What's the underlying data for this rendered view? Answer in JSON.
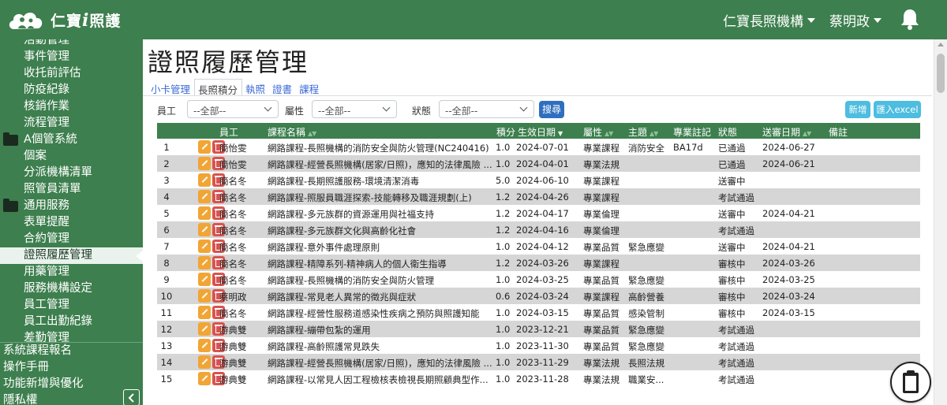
{
  "header": {
    "logo_text": "仁寶",
    "logo_i": "i",
    "logo_text2": "照護",
    "org_name": "仁寶長照機構",
    "user_name": "蔡明政",
    "icons": [
      "cloud-logo-icon",
      "bell-icon",
      "caret-down-icon"
    ]
  },
  "sidebar": {
    "items_upper": [
      {
        "label": "活動管理",
        "type": "item"
      },
      {
        "label": "事件管理",
        "type": "item"
      },
      {
        "label": "收托前評估",
        "type": "item"
      },
      {
        "label": "防疫紀錄",
        "type": "item"
      },
      {
        "label": "核銷作業",
        "type": "item"
      },
      {
        "label": "流程管理",
        "type": "item"
      },
      {
        "label": "A個管系統",
        "type": "group"
      },
      {
        "label": "個案",
        "type": "item"
      },
      {
        "label": "分派機構清單",
        "type": "item"
      },
      {
        "label": "照管員清單",
        "type": "item"
      },
      {
        "label": "通用服務",
        "type": "group"
      },
      {
        "label": "表單提醒",
        "type": "item"
      },
      {
        "label": "合約管理",
        "type": "item"
      },
      {
        "label": "證照履歷管理",
        "type": "item",
        "active": true
      },
      {
        "label": "用藥管理",
        "type": "item"
      },
      {
        "label": "服務機構設定",
        "type": "item"
      },
      {
        "label": "員工管理",
        "type": "item"
      },
      {
        "label": "員工出勤紀錄",
        "type": "item"
      },
      {
        "label": "差勤管理",
        "type": "item"
      }
    ],
    "items_lower": [
      {
        "label": "系統課程報名"
      },
      {
        "label": "操作手冊"
      },
      {
        "label": "功能新增與優化"
      },
      {
        "label": "隱私權"
      }
    ]
  },
  "page": {
    "title": "證照履歷管理",
    "tabs": [
      {
        "label": "小卡管理",
        "active": false
      },
      {
        "label": "長照積分",
        "active": true
      },
      {
        "label": "執照",
        "active": false
      },
      {
        "label": "證書",
        "active": false
      },
      {
        "label": "課程",
        "active": false
      }
    ],
    "filters": {
      "employee_label": "員工",
      "employee_value": "--全部--",
      "attribute_label": "屬性",
      "attribute_value": "--全部--",
      "status_label": "狀態",
      "status_value": "--全部--",
      "search_button": "搜尋",
      "new_button": "新增",
      "import_button": "匯入excel"
    }
  },
  "table": {
    "headers": {
      "employee": "員工",
      "course": "課程名稱",
      "points": "積分",
      "date": "生效日期",
      "attribute": "屬性",
      "topic": "主題",
      "note_code": "專業註記",
      "status": "狀態",
      "submit_date": "送審日期",
      "remark": "備註"
    },
    "rows": [
      {
        "no": "1",
        "employee": "簡怡雯",
        "course": "網路課程-長照機構的消防安全與防火管理(NC240416)",
        "points": "1.0",
        "date": "2024-07-01",
        "attribute": "專業課程",
        "topic": "消防安全",
        "note_code": "BA17d",
        "status": "已通過",
        "submit_date": "2024-06-27"
      },
      {
        "no": "2",
        "employee": "簡怡雯",
        "course": "網路課程-經營長照機構(居家/日照)，應知的法律風險 ...",
        "points": "1.0",
        "date": "2024-04-01",
        "attribute": "專業法規",
        "topic": "",
        "note_code": "",
        "status": "已通過",
        "submit_date": "2024-06-21"
      },
      {
        "no": "3",
        "employee": "簡名冬",
        "course": "網路課程-長期照護服務-環境清潔消毒",
        "points": "5.0",
        "date": "2024-06-10",
        "attribute": "專業課程",
        "topic": "",
        "note_code": "",
        "status": "送審中",
        "submit_date": ""
      },
      {
        "no": "4",
        "employee": "簡名冬",
        "course": "網路課程-照服員職涯探索-技能轉移及職涯規劃(上)",
        "points": "1.2",
        "date": "2024-04-26",
        "attribute": "專業課程",
        "topic": "",
        "note_code": "",
        "status": "考試通過",
        "submit_date": ""
      },
      {
        "no": "5",
        "employee": "簡名冬",
        "course": "網路課程-多元族群的資源運用與社福支持",
        "points": "1.2",
        "date": "2024-04-17",
        "attribute": "專業倫理",
        "topic": "",
        "note_code": "",
        "status": "送審中",
        "submit_date": "2024-04-21"
      },
      {
        "no": "6",
        "employee": "簡名冬",
        "course": "網路課程-多元族群文化與高齡化社會",
        "points": "1.2",
        "date": "2024-04-16",
        "attribute": "專業倫理",
        "topic": "",
        "note_code": "",
        "status": "考試通過",
        "submit_date": ""
      },
      {
        "no": "7",
        "employee": "簡名冬",
        "course": "網路課程-意外事件處理原則",
        "points": "1.0",
        "date": "2024-04-12",
        "attribute": "專業品質",
        "topic": "緊急應變",
        "note_code": "",
        "status": "送審中",
        "submit_date": "2024-04-21"
      },
      {
        "no": "8",
        "employee": "簡名冬",
        "course": "網路課程-精障系列-精神病人的個人衛生指導",
        "points": "1.2",
        "date": "2024-03-26",
        "attribute": "專業課程",
        "topic": "",
        "note_code": "",
        "status": "審核中",
        "submit_date": "2024-03-26"
      },
      {
        "no": "9",
        "employee": "簡名冬",
        "course": "網路課程-長照機構的消防安全與防火管理",
        "points": "1.0",
        "date": "2024-03-25",
        "attribute": "專業品質",
        "topic": "緊急應變",
        "note_code": "",
        "status": "審核中",
        "submit_date": "2024-03-25"
      },
      {
        "no": "10",
        "employee": "蔡明政",
        "course": "網路課程-常見老人異常的徵兆與症狀",
        "points": "0.6",
        "date": "2024-03-24",
        "attribute": "專業課程",
        "topic": "高齡營養",
        "note_code": "",
        "status": "審核中",
        "submit_date": "2024-03-24"
      },
      {
        "no": "11",
        "employee": "簡名冬",
        "course": "網路課程-經營性服務道感染性疾病之預防與照護知能",
        "points": "1.0",
        "date": "2024-03-15",
        "attribute": "專業品質",
        "topic": "感染管制",
        "note_code": "",
        "status": "審核中",
        "submit_date": "2024-03-15"
      },
      {
        "no": "12",
        "employee": "游典雙",
        "course": "網路課程-繃帶包紮的運用",
        "points": "1.0",
        "date": "2023-12-21",
        "attribute": "專業品質",
        "topic": "緊急應變",
        "note_code": "",
        "status": "考試通過",
        "submit_date": ""
      },
      {
        "no": "13",
        "employee": "游典雙",
        "course": "網路課程-高齡照護常見跌失",
        "points": "1.0",
        "date": "2023-11-30",
        "attribute": "專業品質",
        "topic": "緊急應變",
        "note_code": "",
        "status": "考試通過",
        "submit_date": ""
      },
      {
        "no": "14",
        "employee": "游典雙",
        "course": "網路課程-經營長照機構(居家/日照)，應知的法律風險 ...",
        "points": "1.0",
        "date": "2023-11-29",
        "attribute": "專業法規",
        "topic": "長照法規",
        "note_code": "",
        "status": "考試通過",
        "submit_date": ""
      },
      {
        "no": "15",
        "employee": "游典雙",
        "course": "網路課程-以常見人因工程檢核表檢視長期照顧典型作...",
        "points": "1.0",
        "date": "2023-11-28",
        "attribute": "專業法規",
        "topic": "職業安...",
        "note_code": "",
        "status": "考試通過",
        "submit_date": ""
      }
    ]
  },
  "colors": {
    "brand_green": "#3d7f4e",
    "row_alt": "#d6d6d6",
    "edit_orange": "#f2a534",
    "delete_red": "#d9534f",
    "search_blue": "#2f6fbf",
    "action_cyan": "#4dbde0"
  }
}
